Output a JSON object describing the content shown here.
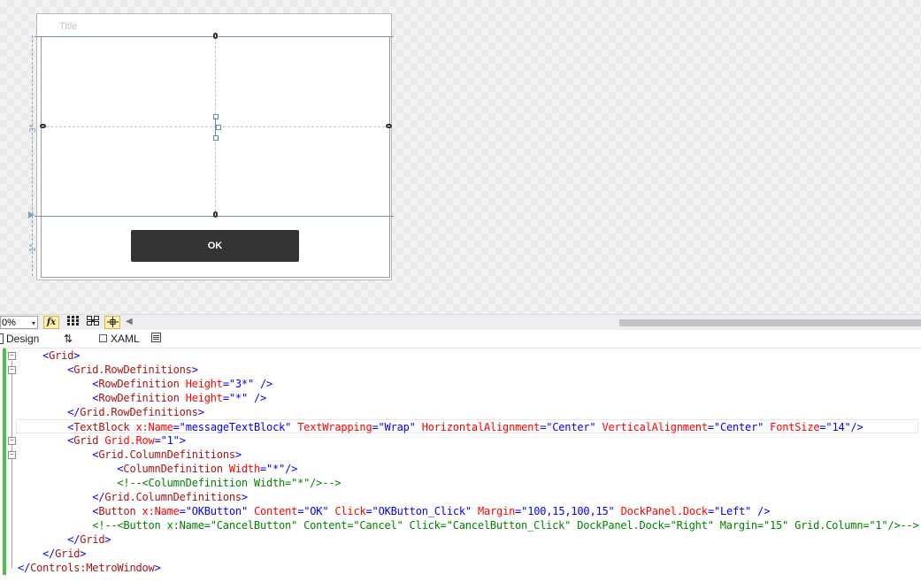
{
  "designer": {
    "window_title": "Title",
    "row_labels": [
      "3*",
      "1*"
    ],
    "ok_button_label": "OK"
  },
  "toolbar": {
    "zoom_value": "0%",
    "zoom_arrow": "▾",
    "fx_label": "fx",
    "icons": [
      "fx-icon",
      "grid-icon",
      "snap-grid-icon",
      "snap-lines-icon",
      "scroll-left-icon"
    ]
  },
  "tabs": {
    "design": "Design",
    "swap": "⇅",
    "xaml": "XAML"
  },
  "code": {
    "lines": [
      [
        [
          "p",
          "    <"
        ],
        [
          "t",
          "Grid"
        ],
        [
          "p",
          ">"
        ]
      ],
      [
        [
          "p",
          "        <"
        ],
        [
          "t",
          "Grid.RowDefinitions"
        ],
        [
          "p",
          ">"
        ]
      ],
      [
        [
          "p",
          "            <"
        ],
        [
          "t",
          "RowDefinition"
        ],
        [
          "p",
          " "
        ],
        [
          "a",
          "Height"
        ],
        [
          "p",
          "=\""
        ],
        [
          "v",
          "3*"
        ],
        [
          "p",
          "\" />"
        ]
      ],
      [
        [
          "p",
          "            <"
        ],
        [
          "t",
          "RowDefinition"
        ],
        [
          "p",
          " "
        ],
        [
          "a",
          "Height"
        ],
        [
          "p",
          "=\""
        ],
        [
          "v",
          "*"
        ],
        [
          "p",
          "\" />"
        ]
      ],
      [
        [
          "p",
          "        </"
        ],
        [
          "t",
          "Grid.RowDefinitions"
        ],
        [
          "p",
          ">"
        ]
      ],
      [
        [
          "p",
          "        <"
        ],
        [
          "t",
          "TextBlock"
        ],
        [
          "p",
          " "
        ],
        [
          "a",
          "x:Name"
        ],
        [
          "p",
          "=\""
        ],
        [
          "v",
          "messageTextBlock"
        ],
        [
          "p",
          "\" "
        ],
        [
          "a",
          "TextWrapping"
        ],
        [
          "p",
          "=\""
        ],
        [
          "v",
          "Wrap"
        ],
        [
          "p",
          "\" "
        ],
        [
          "a",
          "HorizontalAlignment"
        ],
        [
          "p",
          "=\""
        ],
        [
          "v",
          "Center"
        ],
        [
          "p",
          "\" "
        ],
        [
          "a",
          "VerticalAlignment"
        ],
        [
          "p",
          "=\""
        ],
        [
          "v",
          "Center"
        ],
        [
          "p",
          "\" "
        ],
        [
          "a",
          "FontSize"
        ],
        [
          "p",
          "=\""
        ],
        [
          "v",
          "14"
        ],
        [
          "p",
          "\"/>"
        ]
      ],
      [
        [
          "p",
          "        <"
        ],
        [
          "t",
          "Grid"
        ],
        [
          "p",
          " "
        ],
        [
          "a",
          "Grid.Row"
        ],
        [
          "p",
          "=\""
        ],
        [
          "v",
          "1"
        ],
        [
          "p",
          "\">"
        ]
      ],
      [
        [
          "p",
          "            <"
        ],
        [
          "t",
          "Grid.ColumnDefinitions"
        ],
        [
          "p",
          ">"
        ]
      ],
      [
        [
          "p",
          "                <"
        ],
        [
          "t",
          "ColumnDefinition"
        ],
        [
          "p",
          " "
        ],
        [
          "a",
          "Width"
        ],
        [
          "p",
          "=\""
        ],
        [
          "v",
          "*"
        ],
        [
          "p",
          "\"/>"
        ]
      ],
      [
        [
          "c",
          "                <!--<ColumnDefinition Width=\"*\"/>-->"
        ]
      ],
      [
        [
          "p",
          "            </"
        ],
        [
          "t",
          "Grid.ColumnDefinitions"
        ],
        [
          "p",
          ">"
        ]
      ],
      [
        [
          "p",
          "            <"
        ],
        [
          "t",
          "Button"
        ],
        [
          "p",
          " "
        ],
        [
          "a",
          "x:Name"
        ],
        [
          "p",
          "=\""
        ],
        [
          "v",
          "OKButton"
        ],
        [
          "p",
          "\" "
        ],
        [
          "a",
          "Content"
        ],
        [
          "p",
          "=\""
        ],
        [
          "v",
          "OK"
        ],
        [
          "p",
          "\" "
        ],
        [
          "a",
          "Click"
        ],
        [
          "p",
          "=\""
        ],
        [
          "v",
          "OKButton_Click"
        ],
        [
          "p",
          "\" "
        ],
        [
          "a",
          "Margin"
        ],
        [
          "p",
          "=\""
        ],
        [
          "v",
          "100,15,100,15"
        ],
        [
          "p",
          "\" "
        ],
        [
          "a",
          "DockPanel.Dock"
        ],
        [
          "p",
          "=\""
        ],
        [
          "v",
          "Left"
        ],
        [
          "p",
          "\" />"
        ]
      ],
      [
        [
          "c",
          "            <!--<Button x:Name=\"CancelButton\" Content=\"Cancel\" Click=\"CancelButton_Click\" DockPanel.Dock=\"Right\" Margin=\"15\" Grid.Column=\"1\"/>-->"
        ]
      ],
      [
        [
          "p",
          "        </"
        ],
        [
          "t",
          "Grid"
        ],
        [
          "p",
          ">"
        ]
      ],
      [
        [
          "p",
          "    </"
        ],
        [
          "t",
          "Grid"
        ],
        [
          "p",
          ">"
        ]
      ],
      [
        [
          "p",
          "</"
        ],
        [
          "t",
          "Controls:MetroWindow"
        ],
        [
          "p",
          ">"
        ]
      ]
    ]
  },
  "colors": {
    "tag": "#a31515",
    "attribute": "#ff0000",
    "value": "#0000ff",
    "punctuation": "#0000ff",
    "comment": "#008000",
    "change_bar": "#4cc04e",
    "button_bg": "#333333"
  }
}
